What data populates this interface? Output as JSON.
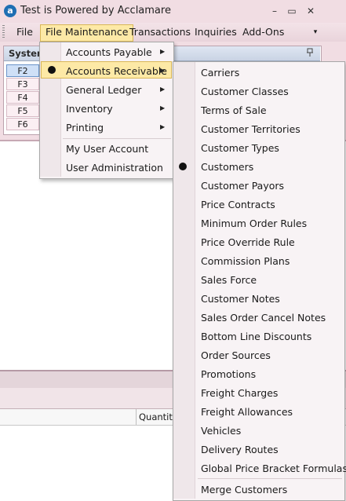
{
  "window": {
    "title": "Test is Powered by Acclamare",
    "logo_letter": "a",
    "minimize": "–",
    "maximize": "▭",
    "close": "✕"
  },
  "menubar": {
    "items": [
      "File",
      "File Maintenance",
      "Transactions",
      "Inquiries",
      "Add-Ons"
    ],
    "overflow": "▾"
  },
  "system_panel": {
    "title": "System",
    "pin": "📌",
    "keys": [
      "F2",
      "F3",
      "F4",
      "F5",
      "F6"
    ]
  },
  "grid": {
    "quantity_header": "Quantity"
  },
  "file_maintenance_menu": {
    "items": [
      {
        "label": "Accounts Payable",
        "submenu": true
      },
      {
        "label": "Accounts Receivable",
        "submenu": true,
        "selected": true
      },
      {
        "label": "General Ledger",
        "submenu": true
      },
      {
        "label": "Inventory",
        "submenu": true
      },
      {
        "label": "Printing",
        "submenu": true
      },
      {
        "label": "My User Account",
        "submenu": false
      },
      {
        "label": "User Administration",
        "submenu": false
      }
    ],
    "arrow": "▶"
  },
  "accounts_receivable_menu": {
    "items": [
      "Carriers",
      "Customer Classes",
      "Terms of Sale",
      "Customer Territories",
      "Customer Types",
      "Customers",
      "Customer Payors",
      "Price Contracts",
      "Minimum Order Rules",
      "Price Override Rule",
      "Commission Plans",
      "Sales Force",
      "Customer Notes",
      "Sales Order Cancel Notes",
      "Bottom Line Discounts",
      "Order Sources",
      "Promotions",
      "Freight Charges",
      "Freight Allowances",
      "Vehicles",
      "Delivery Routes",
      "Global Price Bracket Formulas",
      "Merge Customers"
    ],
    "selected": "Customers"
  }
}
